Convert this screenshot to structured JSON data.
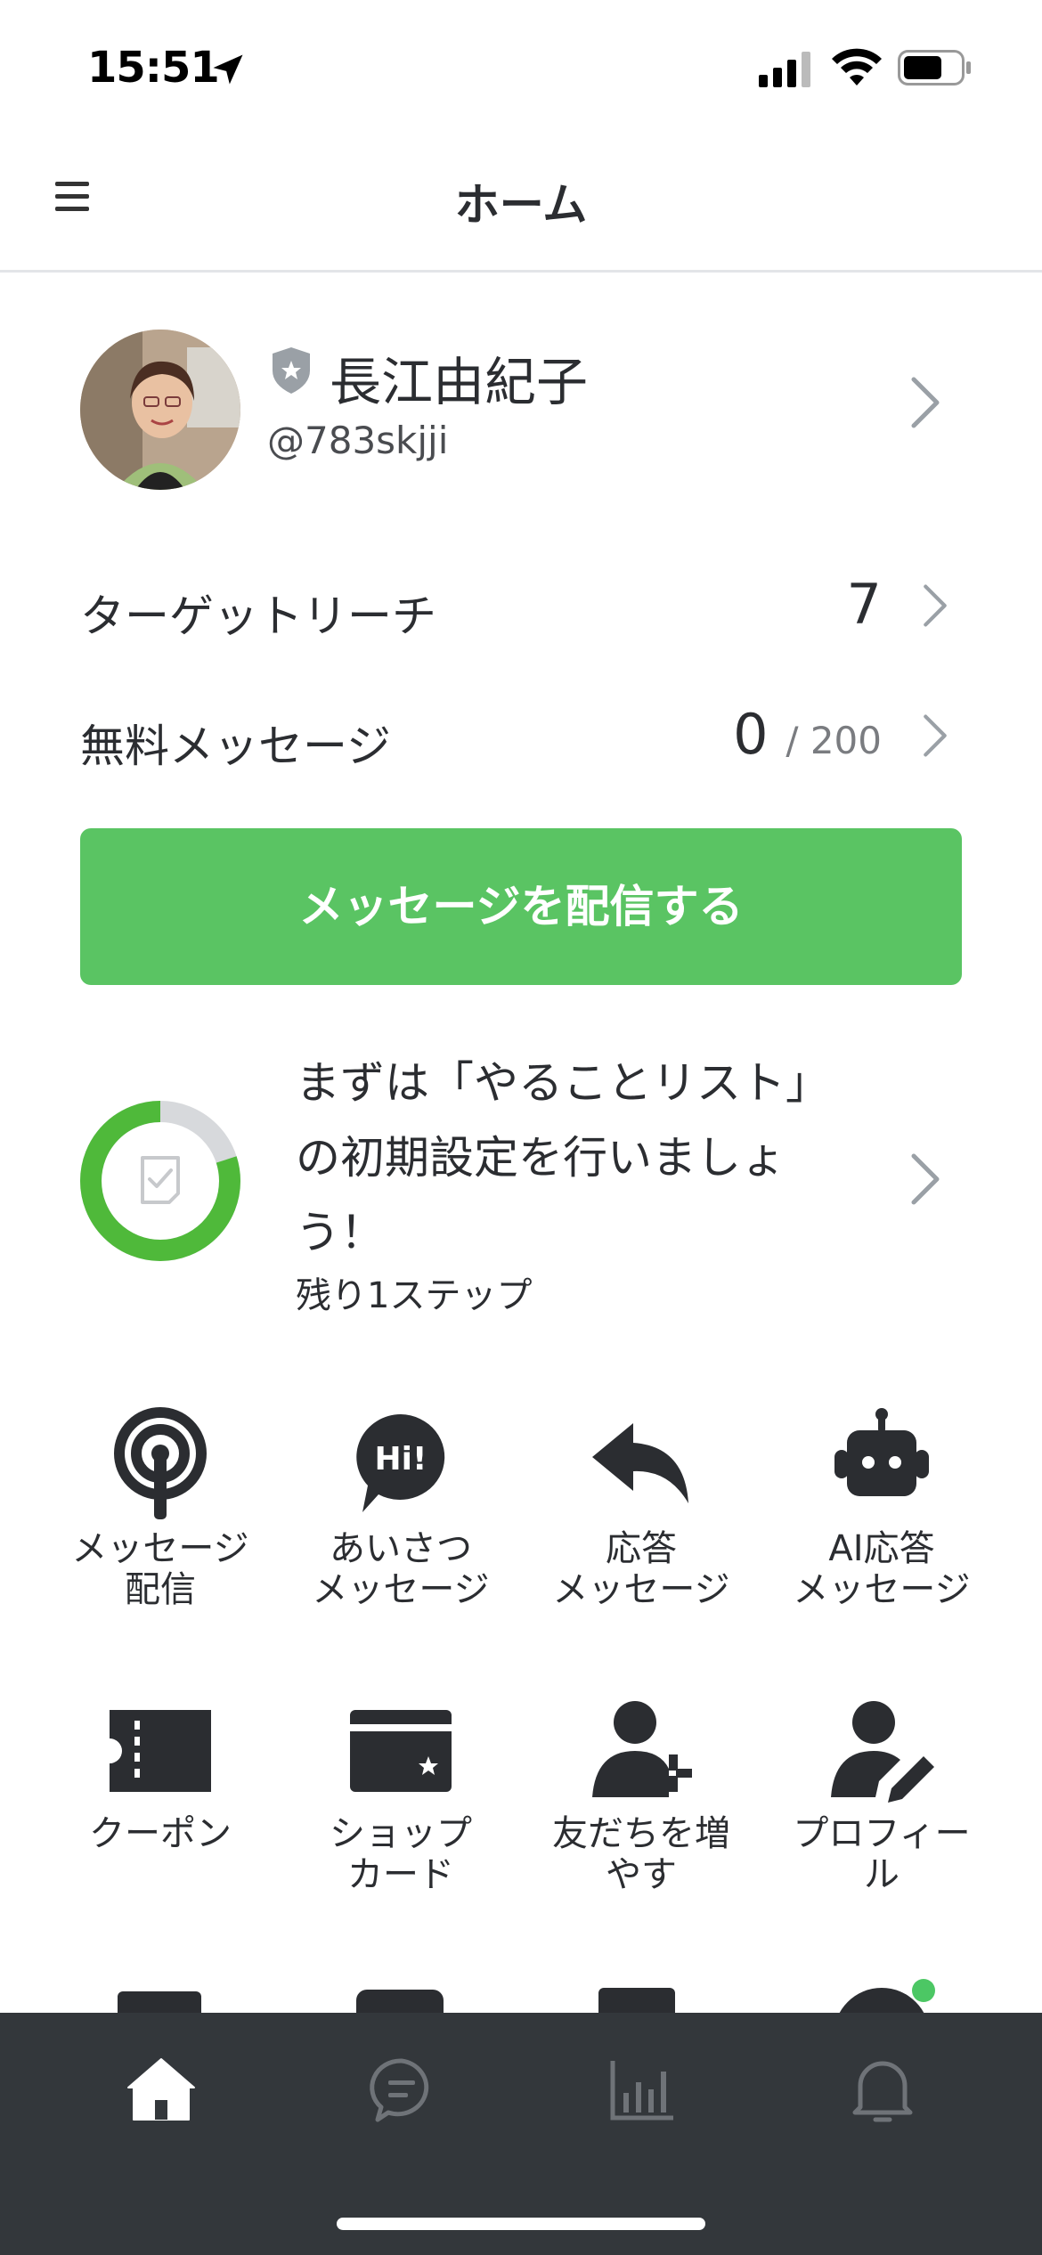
{
  "status_bar": {
    "time": "15:51"
  },
  "header": {
    "title": "ホーム"
  },
  "profile": {
    "name": "長江由紀子",
    "id": "@783skjji"
  },
  "stats": [
    {
      "label": "ターゲットリーチ",
      "value": "7"
    },
    {
      "label": "無料メッセージ",
      "value": "0",
      "limit": "/ 200"
    }
  ],
  "cta": {
    "label": "メッセージを配信する"
  },
  "todo": {
    "text": "まずは「やることリスト」の初期設定を行いましょう！",
    "remaining": "残り1ステップ",
    "progress_fraction": 0.8
  },
  "grid": [
    {
      "icon": "broadcast-icon",
      "label": "メッセージ\n配信"
    },
    {
      "icon": "greeting-hi-icon",
      "label": "あいさつ\nメッセージ"
    },
    {
      "icon": "reply-arrow-icon",
      "label": "応答\nメッセージ"
    },
    {
      "icon": "ai-robot-icon",
      "label": "AI応答\nメッセージ"
    },
    {
      "icon": "coupon-icon",
      "label": "クーポン"
    },
    {
      "icon": "shop-card-icon",
      "label": "ショップ\nカード"
    },
    {
      "icon": "add-friend-icon",
      "label": "友だちを増\nやす"
    },
    {
      "icon": "profile-edit-icon",
      "label": "プロフィー\nル"
    }
  ],
  "tabbar": {
    "tabs": [
      {
        "icon": "home-icon",
        "active": true
      },
      {
        "icon": "chat-icon",
        "active": false
      },
      {
        "icon": "analytics-icon",
        "active": false
      },
      {
        "icon": "bell-icon",
        "active": false
      }
    ]
  },
  "colors": {
    "accent": "#5ac463",
    "tabbar": "#33373b",
    "text": "#2b2d31",
    "ring_track": "#d7d9dc"
  }
}
